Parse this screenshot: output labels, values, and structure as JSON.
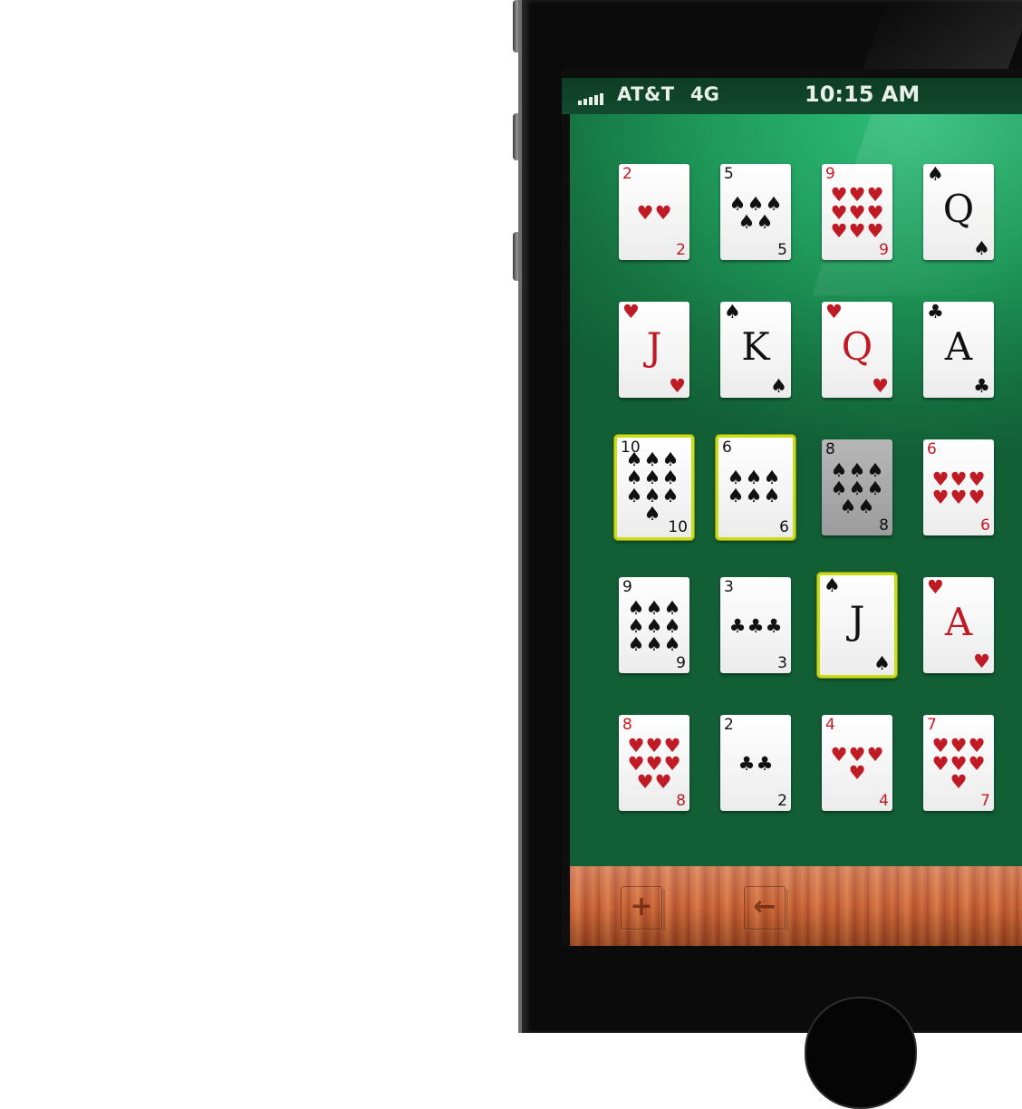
{
  "status_bar": {
    "carrier": "AT&T",
    "network": "4G",
    "time": "10:15 AM"
  },
  "cards": [
    {
      "rank": "2",
      "suit": "♥",
      "color": "red",
      "face": false,
      "pips": 2,
      "selected": false,
      "dimmed": false
    },
    {
      "rank": "5",
      "suit": "♠",
      "color": "black",
      "face": false,
      "pips": 5,
      "selected": false,
      "dimmed": false
    },
    {
      "rank": "9",
      "suit": "♥",
      "color": "red",
      "face": false,
      "pips": 9,
      "selected": false,
      "dimmed": false
    },
    {
      "rank": "Q",
      "suit": "♠",
      "color": "black",
      "face": true,
      "pips": 0,
      "selected": false,
      "dimmed": false
    },
    {
      "rank": "J",
      "suit": "♥",
      "color": "red",
      "face": true,
      "pips": 0,
      "selected": false,
      "dimmed": false
    },
    {
      "rank": "K",
      "suit": "♠",
      "color": "black",
      "face": true,
      "pips": 0,
      "selected": false,
      "dimmed": false
    },
    {
      "rank": "Q",
      "suit": "♥",
      "color": "red",
      "face": true,
      "pips": 0,
      "selected": false,
      "dimmed": false
    },
    {
      "rank": "A",
      "suit": "♣",
      "color": "black",
      "face": true,
      "pips": 0,
      "selected": false,
      "dimmed": false
    },
    {
      "rank": "10",
      "suit": "♠",
      "color": "black",
      "face": false,
      "pips": 10,
      "selected": true,
      "dimmed": false
    },
    {
      "rank": "6",
      "suit": "♠",
      "color": "black",
      "face": false,
      "pips": 6,
      "selected": true,
      "dimmed": false
    },
    {
      "rank": "8",
      "suit": "♠",
      "color": "black",
      "face": false,
      "pips": 8,
      "selected": false,
      "dimmed": true
    },
    {
      "rank": "6",
      "suit": "♥",
      "color": "red",
      "face": false,
      "pips": 6,
      "selected": false,
      "dimmed": false
    },
    {
      "rank": "9",
      "suit": "♠",
      "color": "black",
      "face": false,
      "pips": 9,
      "selected": false,
      "dimmed": false
    },
    {
      "rank": "3",
      "suit": "♣",
      "color": "black",
      "face": false,
      "pips": 3,
      "selected": false,
      "dimmed": false
    },
    {
      "rank": "J",
      "suit": "♠",
      "color": "black",
      "face": true,
      "pips": 0,
      "selected": true,
      "dimmed": false
    },
    {
      "rank": "A",
      "suit": "♥",
      "color": "red",
      "face": true,
      "pips": 0,
      "selected": false,
      "dimmed": false
    },
    {
      "rank": "8",
      "suit": "♥",
      "color": "red",
      "face": false,
      "pips": 8,
      "selected": false,
      "dimmed": false
    },
    {
      "rank": "2",
      "suit": "♣",
      "color": "black",
      "face": false,
      "pips": 2,
      "selected": false,
      "dimmed": false
    },
    {
      "rank": "4",
      "suit": "♥",
      "color": "red",
      "face": false,
      "pips": 4,
      "selected": false,
      "dimmed": false
    },
    {
      "rank": "7",
      "suit": "♥",
      "color": "red",
      "face": false,
      "pips": 7,
      "selected": false,
      "dimmed": false
    }
  ],
  "toolbar": {
    "add_icon": "plus-icon",
    "add_glyph": "+",
    "back_icon": "arrow-left-icon",
    "back_glyph": "←"
  },
  "colors": {
    "felt": "#1f9a5a",
    "selection": "#c8dd18",
    "red_suit": "#c01b25"
  }
}
